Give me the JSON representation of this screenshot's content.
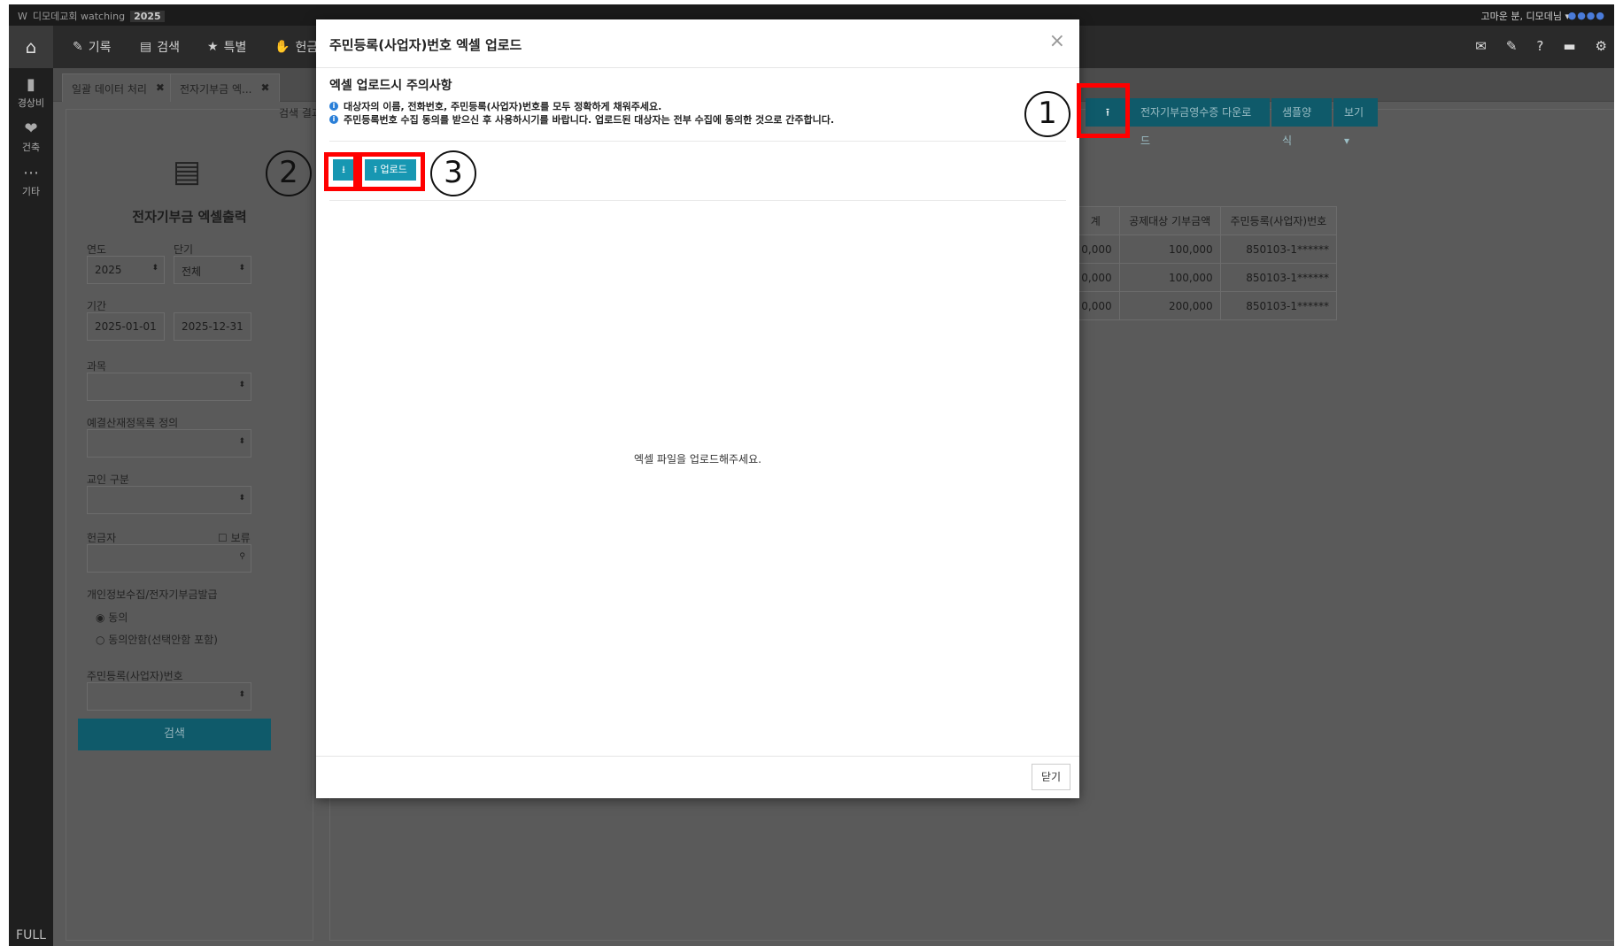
{
  "topbar": {
    "app": "디모데교회 watching",
    "year": "2025",
    "user": "고마운 분, 디모데님 ▾"
  },
  "nav": {
    "items": [
      "기록",
      "검색",
      "특별",
      "헌금"
    ]
  },
  "side": {
    "item1": "경상비",
    "item2": "건축",
    "item3": "기타",
    "full": "FULL"
  },
  "tabs": [
    "일괄 데이터 처리",
    "전자기부금 엑..."
  ],
  "left": {
    "title": "전자기부금 엑셀출력",
    "year_label": "연도",
    "year_value": "2025",
    "term_label": "단기",
    "term_value": "전체",
    "period_label": "기간",
    "date_from": "2025-01-01",
    "date_to": "2025-12-31",
    "subject_label": "과목",
    "budget_label": "예결산재정목록 정의",
    "member_label": "교인 구분",
    "donor_label": "헌금자",
    "hold_label": "보류",
    "privacy_label": "개인정보수집/전자기부금발급",
    "agree": "동의",
    "disagree": "동의안함(선택안함 포함)",
    "resident_label": "주민등록(사업자)번호",
    "search_btn": "검색"
  },
  "right": {
    "result_label": "검색 결과",
    "btn_download": "전자기부금영수증 다운로드",
    "btn_sample": "샘플양식",
    "btn_view": "보기 ▾",
    "table": {
      "headers": [
        "계",
        "공제대상 기부금액",
        "주민등록(사업자)번호"
      ],
      "rows": [
        [
          "0,000",
          "100,000",
          "850103-1******"
        ],
        [
          "0,000",
          "100,000",
          "850103-1******"
        ],
        [
          "0,000",
          "200,000",
          "850103-1******"
        ]
      ]
    }
  },
  "modal": {
    "title": "주민등록(사업자)번호 엑셀 업로드",
    "close": "×",
    "subtitle": "엑셀 업로드시 주의사항",
    "note1": "대상자의 이름, 전화번호, 주민등록(사업자)번호를 모두 정확하게 채워주세요.",
    "note2": "주민등록번호 수집 동의를 받으신 후 사용하시기를 바랍니다. 업로드된 대상자는 전부 수집에 동의한 것으로 간주합니다.",
    "download_btn": "⭳",
    "upload_btn": "업로드",
    "empty_msg": "엑셀 파일을 업로드해주세요.",
    "footer_btn": "닫기"
  },
  "annotations": {
    "c1": "1",
    "c2": "2",
    "c3": "3"
  }
}
